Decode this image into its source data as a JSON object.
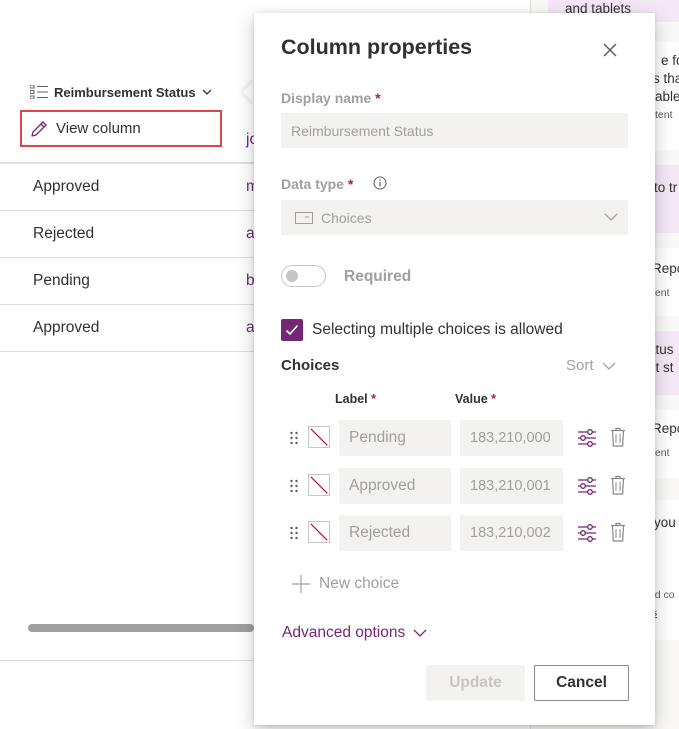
{
  "grid": {
    "column_header": "Reimbursement Status",
    "view_column_label": "View column",
    "first_row_owner": "jo",
    "rows": [
      {
        "status": "Approved",
        "owner": "m"
      },
      {
        "status": "Rejected",
        "owner": "a"
      },
      {
        "status": "Pending",
        "owner": "b"
      },
      {
        "status": "Approved",
        "owner": "a"
      }
    ]
  },
  "right_panel": {
    "cards": [
      {
        "text": "and tablets",
        "pink": true
      },
      {
        "text": "e for",
        "sub": "",
        "pink": false
      },
      {
        "text": "s tha",
        "pink": false
      },
      {
        "text": "ablet",
        "pink": false
      },
      {
        "text": "tent",
        "pink": false
      },
      {
        "text": "to tr",
        "pink": true
      },
      {
        "text": "Repo",
        "pink": false
      },
      {
        "text": "tent",
        "pink": false
      },
      {
        "text": "atus",
        "pink": true
      },
      {
        "text": "nt st",
        "pink": true
      },
      {
        "text": "Repo",
        "pink": false
      },
      {
        "text": "tent",
        "pink": false
      },
      {
        "text": "you",
        "pink": false
      },
      {
        "text": "ted co",
        "pink": false
      },
      {
        "text": "ns",
        "pink": false
      }
    ]
  },
  "dialog": {
    "title": "Column properties",
    "display_name_label": "Display name",
    "required_marker": "*",
    "display_name_value": "Reimbursement Status",
    "data_type_label": "Data type",
    "data_type_value": "Choices",
    "required_label": "Required",
    "multi_select_label": "Selecting multiple choices is allowed",
    "multi_select_checked": true,
    "choices_heading": "Choices",
    "sort_label": "Sort",
    "label_header": "Label",
    "value_header": "Value",
    "choices": [
      {
        "label": "Pending",
        "value": "183,210,000"
      },
      {
        "label": "Approved",
        "value": "183,210,001"
      },
      {
        "label": "Rejected",
        "value": "183,210,002"
      }
    ],
    "new_choice_label": "New choice",
    "advanced_options_label": "Advanced options",
    "update_label": "Update",
    "cancel_label": "Cancel"
  },
  "colors": {
    "accent": "#742774",
    "link": "#6b2a7f",
    "required": "#a4262c",
    "highlight_box": "#e04343"
  },
  "icons": [
    "list-icon",
    "chevron-down-icon",
    "pencil-icon",
    "close-icon",
    "info-icon",
    "choices-icon",
    "checkmark-icon",
    "drag-handle-icon",
    "color-swatch-icon",
    "settings-icon",
    "trash-icon",
    "plus-icon"
  ]
}
